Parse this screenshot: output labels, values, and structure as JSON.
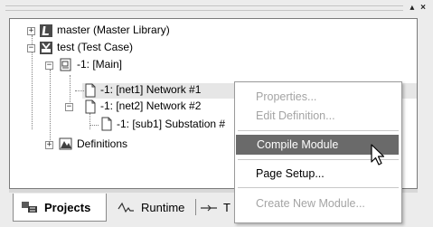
{
  "window": {
    "controls_label": "▴ ×"
  },
  "tree": {
    "nodes": [
      {
        "label": "master (Master Library)",
        "icon": "library-icon",
        "toggle": "+"
      },
      {
        "label": "test (Test Case)",
        "icon": "test-case-icon",
        "toggle": "−"
      },
      {
        "label": "-1: [Main]",
        "icon": "module-icon",
        "toggle": "−"
      },
      {
        "label": "-1: [net1] Network #1",
        "icon": "network-page-icon",
        "toggle": ""
      },
      {
        "label": "-1: [net2] Network #2",
        "icon": "network-page-icon",
        "toggle": "−"
      },
      {
        "label": "-1: [sub1] Substation #",
        "icon": "network-page-icon",
        "toggle": ""
      },
      {
        "label": "Definitions",
        "icon": "definitions-icon",
        "toggle": "+"
      }
    ]
  },
  "context_menu": {
    "items": [
      {
        "label": "Properties...",
        "state": "disabled"
      },
      {
        "label": "Edit Definition...",
        "state": "disabled"
      },
      {
        "label": "Compile Module",
        "state": "highlighted"
      },
      {
        "label": "Page Setup...",
        "state": "enabled"
      },
      {
        "label": "Create New Module...",
        "state": "disabled"
      }
    ]
  },
  "tabs": [
    {
      "label": "Projects",
      "icon": "projects-icon",
      "active": true
    },
    {
      "label": "Runtime",
      "icon": "runtime-wave-icon",
      "active": false
    },
    {
      "label": "T",
      "icon": "transfer-icon",
      "active": false
    }
  ],
  "colors": {
    "menu_highlight": "#6a6a6a",
    "disabled_text": "#a4a4a4",
    "row_highlight": "#e6e6e6"
  }
}
